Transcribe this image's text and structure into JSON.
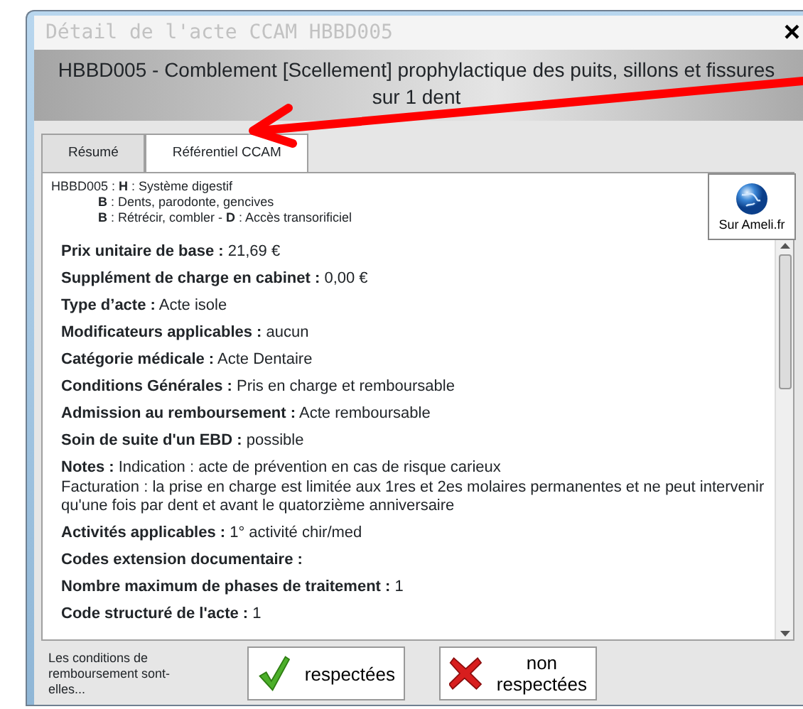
{
  "window": {
    "title": "Détail de l'acte CCAM HBBD005",
    "close": "×"
  },
  "header": "HBBD005 - Comblement [Scellement] prophylactique des puits, sillons et fissures sur 1 dent",
  "tabs": [
    {
      "label": "Résumé",
      "selected": false
    },
    {
      "label": "Référentiel CCAM",
      "selected": true
    }
  ],
  "code_breakdown": [
    "HBBD005 : **H** : Système digestif",
    "**B** : Dents, parodonte, gencives",
    "**B** : Rétrécir, combler   -   **D** : Accès transorificiel"
  ],
  "ameli_button": "Sur Ameli.fr",
  "fields": [
    {
      "label": "Prix unitaire de base :",
      "value": [
        "21,69 €"
      ]
    },
    {
      "label": "Supplément de charge en cabinet :",
      "value": [
        "0,00 €"
      ]
    },
    {
      "label": "Type d’acte :",
      "value": [
        "Acte isole"
      ]
    },
    {
      "label": "Modificateurs applicables :",
      "value": [
        "aucun"
      ]
    },
    {
      "label": "Catégorie médicale :",
      "value": [
        "Acte Dentaire"
      ]
    },
    {
      "label": "Conditions Générales :",
      "value": [
        "Pris en charge et remboursable"
      ]
    },
    {
      "label": "Admission au remboursement :",
      "value": [
        "Acte remboursable"
      ]
    },
    {
      "label": "Soin de suite d'un EBD :",
      "value": [
        "possible"
      ]
    },
    {
      "label": "Notes :",
      "value": [
        "Indication : acte de prévention en cas de risque carieux",
        "Facturation : la prise en charge est limitée aux 1res et 2es molaires permanentes et ne peut intervenir qu'une fois par dent et avant le quatorzième anniversaire"
      ]
    },
    {
      "label": "Activités applicables :",
      "value": [
        "1° activité chir/med"
      ]
    },
    {
      "label": "Codes extension documentaire :"
    },
    {
      "label": "Nombre maximum de phases de traitement :",
      "value": [
        "1"
      ]
    },
    {
      "label": "Code structuré de l'acte :",
      "value": [
        "1"
      ]
    }
  ],
  "footer": {
    "prompt": "Les conditions de remboursement sont-elles...",
    "buttons": [
      {
        "label": "respectées",
        "kind": "accept"
      },
      {
        "label": "non respectées",
        "kind": "reject"
      }
    ]
  }
}
